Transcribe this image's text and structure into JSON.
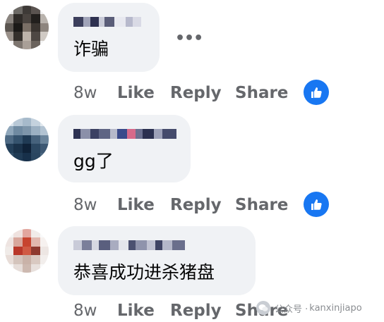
{
  "comments": [
    {
      "text": "诈骗",
      "time": "8w",
      "like_label": "Like",
      "reply_label": "Reply",
      "share_label": "Share",
      "reaction": "like-icon",
      "has_more": true,
      "more_label": "•••"
    },
    {
      "text": "gg了",
      "time": "8w",
      "like_label": "Like",
      "reply_label": "Reply",
      "share_label": "Share",
      "reaction": "like-icon"
    },
    {
      "text": "恭喜成功进杀猪盘",
      "time": "8w",
      "like_label": "Like",
      "reply_label": "Reply",
      "share_label": "Share"
    }
  ],
  "watermark": {
    "separator": "公众号 · ",
    "account": "kanxinjiapo",
    "icon": "wechat-icon"
  },
  "colors": {
    "bubble": "#f0f2f5",
    "action_text": "#65676b",
    "like_badge": "#1877f2"
  }
}
